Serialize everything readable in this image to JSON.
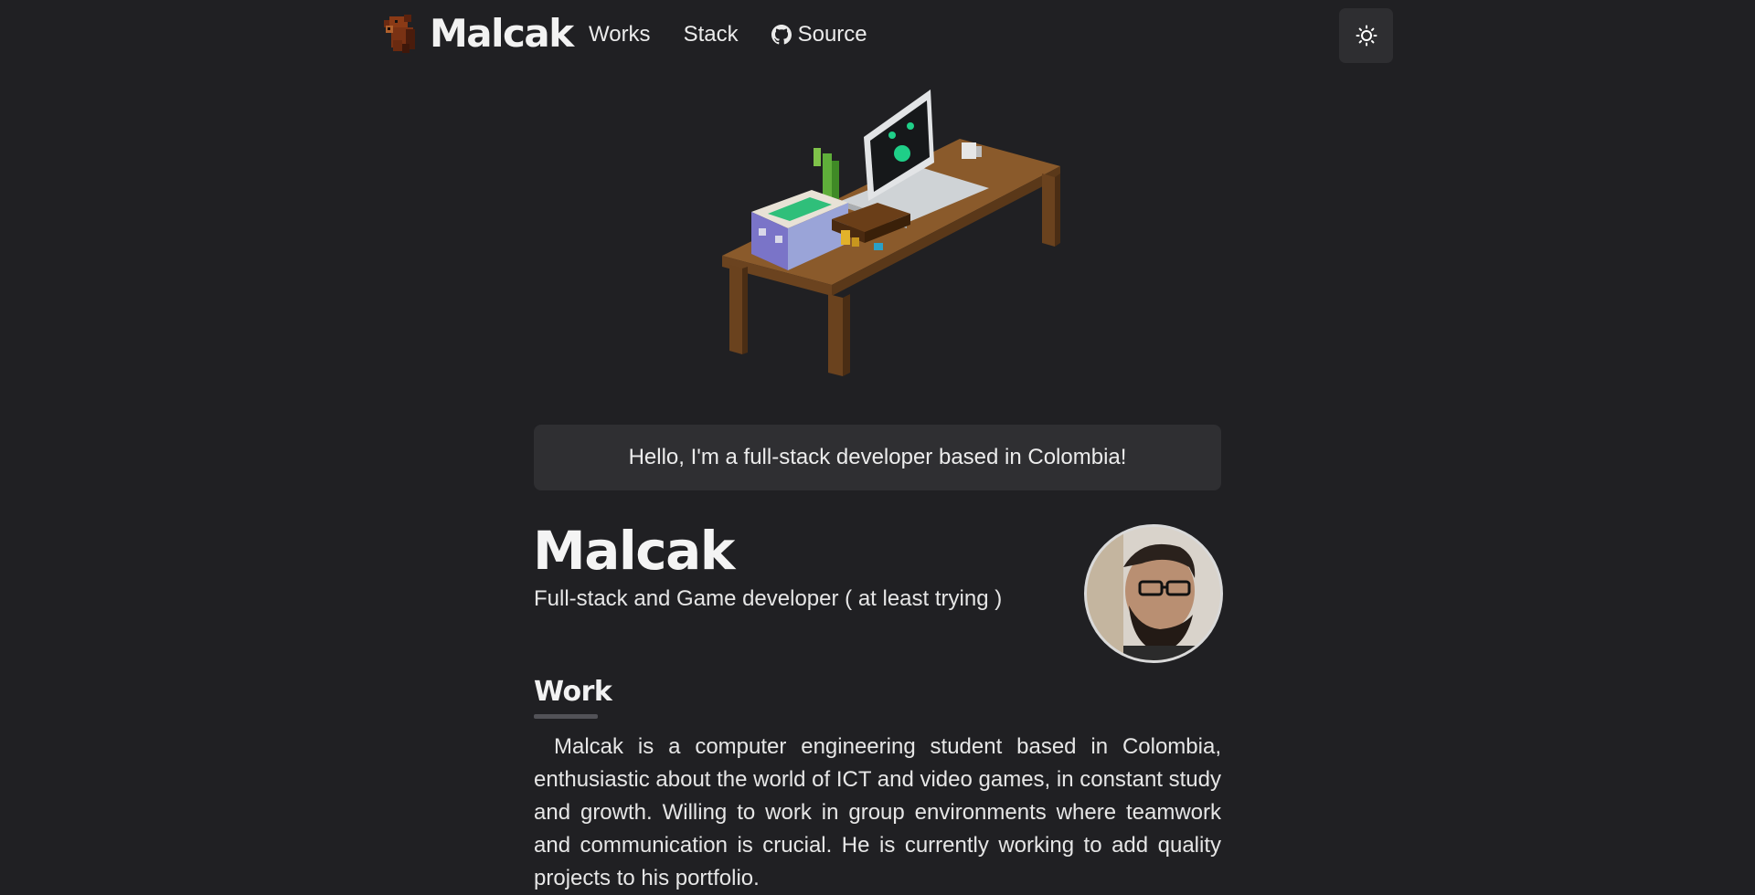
{
  "nav": {
    "logo_text": "Malcak",
    "logo_icon": "bear-icon",
    "links": [
      {
        "label": "Works"
      },
      {
        "label": "Stack"
      },
      {
        "label": "Source",
        "icon": "github-icon"
      }
    ],
    "theme_toggle_icon": "sun-icon"
  },
  "hero": {
    "image": "voxel-desk-illustration"
  },
  "greeting": "Hello, I'm a full-stack developer based in Colombia!",
  "profile": {
    "name": "Malcak",
    "role": "Full-stack and Game developer ( at least trying )"
  },
  "work": {
    "title": "Work",
    "text": "Malcak is a computer engineering student based in Colombia, enthusiastic about the world of ICT and video games, in constant study and growth. Willing to work in group environments where teamwork and communication is crucial. He is currently working to add quality projects to his portfolio."
  },
  "colors": {
    "background": "#202023",
    "card": "#2f2f32",
    "text": "#ebebeb",
    "accent_green": "#1fcf88"
  }
}
